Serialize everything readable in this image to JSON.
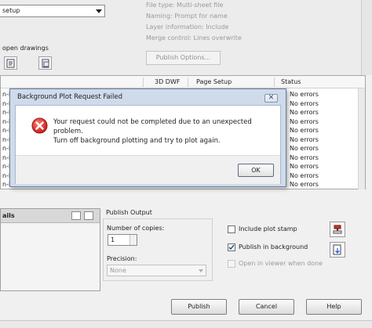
{
  "top": {
    "setup_combo_value": "setup",
    "open_drawings_label": "open drawings",
    "publish_info": [
      "File type: Multi-sheet file",
      "Naming: Prompt for name",
      "Layer information: Include",
      "Merge control: Lines overwrite"
    ],
    "publish_options_label": "Publish Options..."
  },
  "sheet_list": {
    "columns": [
      "3D DWF",
      "Page Setup",
      "Status"
    ],
    "rows": [
      {
        "name": "n-F",
        "status": "No errors"
      },
      {
        "name": "n-F",
        "status": "No errors"
      },
      {
        "name": "n-F",
        "status": "No errors"
      },
      {
        "name": "n-F",
        "status": "No errors"
      },
      {
        "name": "n-F",
        "status": "No errors"
      },
      {
        "name": "n-F",
        "status": "No errors"
      },
      {
        "name": "n-F",
        "status": "No errors"
      },
      {
        "name": "n-F",
        "status": "No errors"
      },
      {
        "name": "n-F",
        "status": "No errors"
      },
      {
        "name": "n-F",
        "status": "No errors"
      },
      {
        "name": "n-R",
        "status": "No errors"
      }
    ]
  },
  "details": {
    "label": "ails"
  },
  "publish_output": {
    "label": "Publish Output",
    "copies_label": "Number of copies:",
    "copies_value": "1",
    "precision_label": "Precision:",
    "precision_value": "None",
    "include_plot_stamp_label": "Include plot stamp",
    "include_plot_stamp_checked": false,
    "publish_in_background_label": "Publish in background",
    "publish_in_background_checked": true,
    "open_in_viewer_label": "Open in viewer when done",
    "open_in_viewer_checked": false
  },
  "buttons": {
    "publish": "Publish",
    "cancel": "Cancel",
    "help": "Help"
  },
  "dialog": {
    "title": "Background Plot Request Failed",
    "close_glyph": "✕",
    "message_line1": "Your request could not be completed due to an unexpected problem.",
    "message_line2": "Turn off background plotting and try to plot again.",
    "ok_label": "OK"
  },
  "colors": {
    "error_red": "#d82b2b",
    "dialog_frame": "#cfdbeb"
  }
}
